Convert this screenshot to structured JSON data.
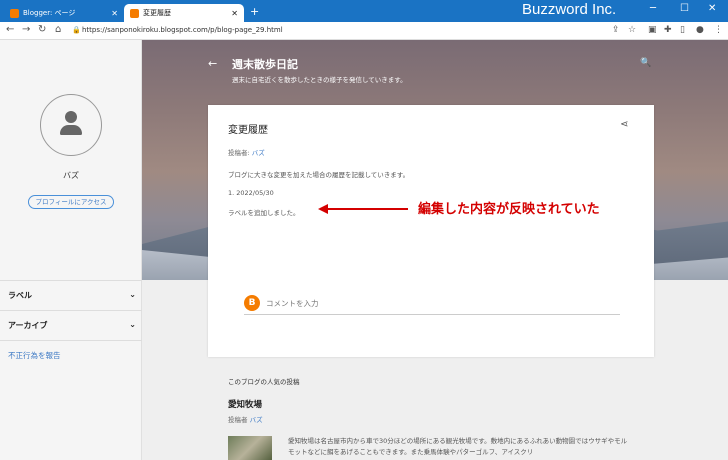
{
  "browser": {
    "tabs": [
      {
        "label": "Blogger: ページ",
        "active": false
      },
      {
        "label": "変更履歴",
        "active": true
      }
    ],
    "brand": "Buzzword Inc.",
    "url": "https://sanponokiroku.blogspot.com/p/blog-page_29.html"
  },
  "sidebar": {
    "profile_name": "バズ",
    "profile_button": "プロフィールにアクセス",
    "sections": [
      {
        "label": "ラベル"
      },
      {
        "label": "アーカイブ"
      }
    ],
    "report_link": "不正行為を報告"
  },
  "header": {
    "blog_title": "週末散歩日記",
    "blog_description": "週末に自宅近くを散歩したときの様子を発信していきます。"
  },
  "post": {
    "title": "変更履歴",
    "author_prefix": "投稿者:",
    "author": "バズ",
    "body": "ブログに大きな変更を加えた場合の履歴を記載していきます。",
    "date_entry": "1. 2022/05/30",
    "note": "ラベルを追加しました。",
    "comment_placeholder": "コメントを入力"
  },
  "annotation": {
    "text": "編集した内容が反映されていた",
    "color": "#d40000"
  },
  "popular": {
    "heading": "このブログの人気の投稿",
    "title": "愛知牧場",
    "author_prefix": "投稿者",
    "author": "バズ",
    "excerpt": "愛知牧場は名古屋市内から車で30分ほどの場所にある観光牧場です。敷地内にあるふれあい動物園ではウサギやモルモットなどに餌をあげることもできます。また乗馬体験やパターゴルフ、アイスクリ"
  },
  "colors": {
    "browser_blue": "#1a73c4",
    "link_blue": "#3b78c4",
    "blogger_orange": "#f57c00"
  }
}
